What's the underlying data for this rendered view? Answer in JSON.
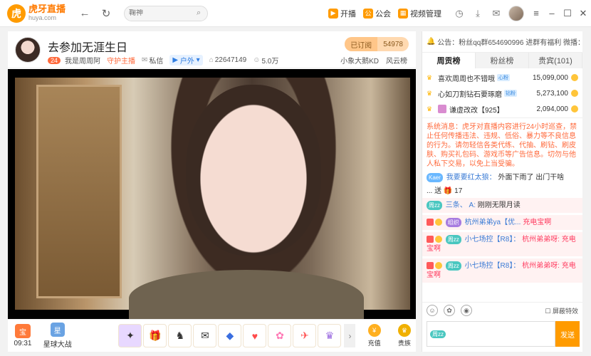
{
  "app": {
    "logo_name": "虎牙直播",
    "logo_url": "huya.com",
    "search_placeholder": "鞠神"
  },
  "topbar": {
    "links": [
      {
        "icon": "kaibo-icon",
        "label": "开播"
      },
      {
        "icon": "guild-icon",
        "label": "公会"
      },
      {
        "icon": "video-manage-icon",
        "label": "视频管理"
      }
    ]
  },
  "room": {
    "title": "去参加无涯生日",
    "level": "24",
    "anchor": "我是周周阿",
    "guard": "守护主播",
    "message": "私信",
    "category": "户外",
    "room_id": "22647149",
    "fans": "5.0万",
    "subscribe_label": "已订阅",
    "subscribe_count": "54978",
    "right_tags": [
      "小象大鹅KD",
      "风云榜"
    ]
  },
  "giftbar": {
    "time": "09:31",
    "xing_label": "星球大战",
    "gifts": [
      "gift",
      "gift",
      "gift",
      "gift",
      "gift",
      "gift",
      "gift",
      "gift",
      "gift"
    ],
    "recharge": "充值",
    "noble": "贵族"
  },
  "side": {
    "notice": "公告：粉丝qq群654690996 进群有福利 微播：周...",
    "tabs": [
      "周贡榜",
      "粉丝榜",
      "贵宾(101)"
    ],
    "rank": [
      {
        "name": "喜欢周周也不错哦",
        "tag": "心粉",
        "value": "15,099,000"
      },
      {
        "name": "心如刀割钻石要琢磨",
        "tag": "钻粉",
        "value": "5,273,100"
      },
      {
        "name": "谦虚改改【925】",
        "tag": "",
        "value": "2,094,000"
      }
    ],
    "system_msg": "系统消息：虎牙对直播内容进行24小时巡查，禁止任何传播违法、违规、低俗、暴力等不良信息的行为。请勿轻信各类代练、代抽、刷钻、刷皮肤、购买礼包码、游戏币等广告信息。切勿与他人私下交易，以免上当受骗。",
    "kaer_msg": {
      "tag": "Kaer",
      "user": "我要要红太狼：",
      "text": "外面下雨了 出门干啥"
    },
    "send_msg": {
      "user": "...",
      "verb": "送",
      "count": "17"
    },
    "msgs": [
      {
        "tag": "周zz",
        "user": "三条、 A:",
        "text": "刚刚无限月读"
      },
      {
        "tag": "组织",
        "user": "杭州弟弟ya【优...",
        "text": "充电宝啊"
      },
      {
        "tag": "周zz",
        "user": "小七场控【R8】：",
        "text": "杭州弟弟呀: 充电宝啊"
      },
      {
        "tag": "周zz",
        "user": "小七场控【R8】：",
        "text": "杭州弟弟呀: 充电宝啊"
      }
    ],
    "block_fx": "屏蔽特效",
    "input_tag": "周zz",
    "send_label": "发送"
  }
}
